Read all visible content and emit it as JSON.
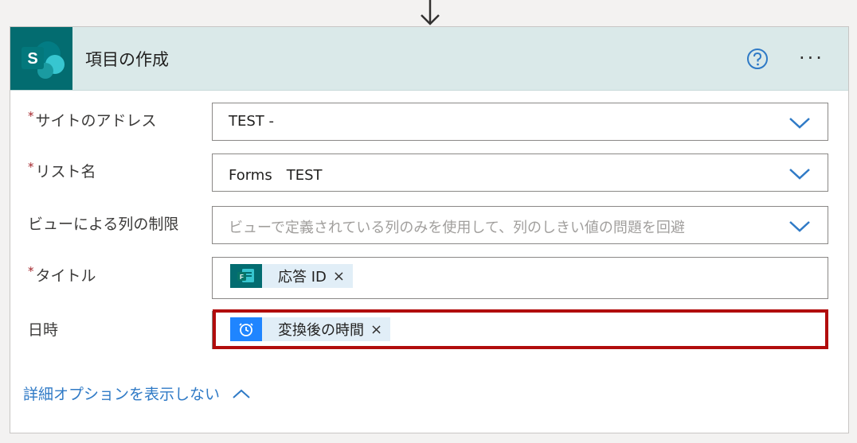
{
  "action": {
    "title": "項目の作成",
    "connector_icon": "sharepoint-icon",
    "help_icon": "help-icon",
    "more_label": "···"
  },
  "fields": {
    "site_address": {
      "label": "サイトのアドレス",
      "required": "*",
      "value": "TEST -"
    },
    "list_name": {
      "label": "リスト名",
      "required": "*",
      "value": "Forms　TEST"
    },
    "limit_columns": {
      "label": "ビューによる列の制限",
      "placeholder": "ビューで定義されている列のみを使用して、列のしきい値の問題を回避"
    },
    "title": {
      "label": "タイトル",
      "required": "*",
      "token_label": "応答 ID",
      "token_icon": "forms-icon",
      "token_remove": "×"
    },
    "datetime": {
      "label": "日時",
      "token_label": "変換後の時間",
      "token_icon": "clock-icon",
      "token_remove": "×"
    }
  },
  "advanced_link": "詳細オプションを表示しない",
  "colors": {
    "header_bg": "#dae9e9",
    "sharepoint": "#036c70",
    "accent": "#2f7ac6",
    "required": "#a4262c",
    "highlight": "#b10c0c"
  }
}
